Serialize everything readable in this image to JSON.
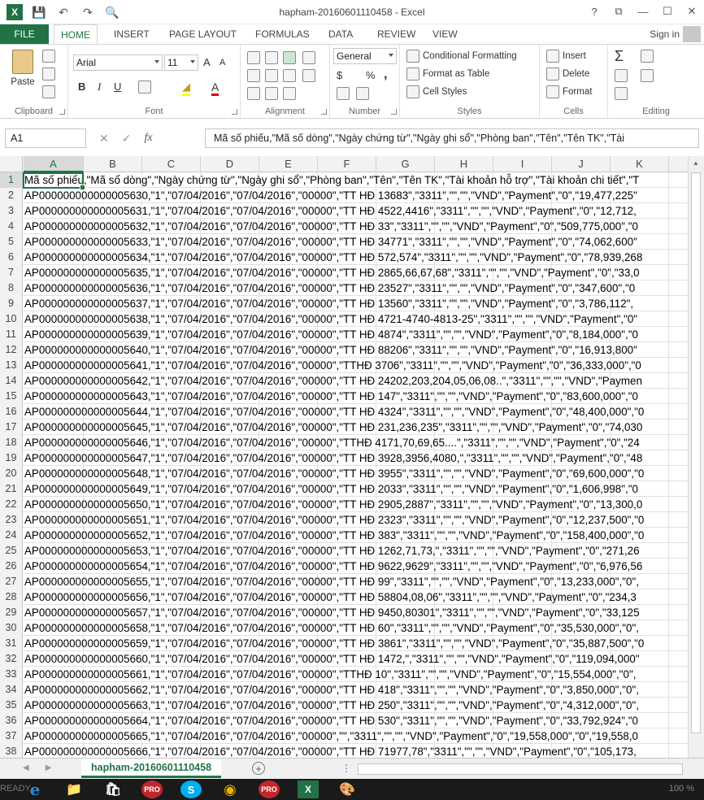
{
  "window": {
    "title": "hapham-20160601110458 - Excel",
    "help": "?",
    "ribbon_display": "⧉",
    "minimize": "—",
    "maximize": "☐",
    "close": "✕"
  },
  "qat": {
    "app_logo": "X",
    "save": "💾",
    "undo": "↶",
    "redo": "↷",
    "preview": "🔍"
  },
  "tabs": {
    "file": "FILE",
    "items": [
      "HOME",
      "INSERT",
      "PAGE LAYOUT",
      "FORMULAS",
      "DATA",
      "REVIEW",
      "VIEW"
    ],
    "signin": "Sign in"
  },
  "ribbon": {
    "clipboard": {
      "label": "Clipboard",
      "paste": "Paste"
    },
    "font": {
      "label": "Font",
      "name": "Arial",
      "size": "11",
      "grow": "A",
      "shrink": "A",
      "bold": "B",
      "italic": "I",
      "underline": "U",
      "fill": "◢",
      "color": "A"
    },
    "alignment": {
      "label": "Alignment"
    },
    "number": {
      "label": "Number",
      "format": "General",
      "currency": "$",
      "percent": "%",
      "comma": ","
    },
    "styles": {
      "label": "Styles",
      "conditional": "Conditional Formatting",
      "table": "Format as Table",
      "cell_styles": "Cell Styles"
    },
    "cells": {
      "label": "Cells",
      "insert": "Insert",
      "delete": "Delete",
      "format": "Format"
    },
    "editing": {
      "label": "Editing",
      "sum": "Σ"
    }
  },
  "formula_bar": {
    "name_box": "A1",
    "cancel": "✕",
    "enter": "✓",
    "fx": "fx",
    "content": "Mã số phiếu,\"Mã số dòng\",\"Ngày chứng từ\",\"Ngày ghi sổ\",\"Phòng ban\",\"Tên\",\"Tên TK\",\"Tài"
  },
  "columns": [
    "A",
    "B",
    "C",
    "D",
    "E",
    "F",
    "G",
    "H",
    "I",
    "J",
    "K"
  ],
  "rows": [
    {
      "n": "1",
      "text": "Mã số phiếu,\"Mã số dòng\",\"Ngày chứng từ\",\"Ngày ghi sổ\",\"Phòng ban\",\"Tên\",\"Tên TK\",\"Tài khoản hỗ trợ\",\"Tài khoản chi tiết\",\"T"
    },
    {
      "n": "2",
      "text": "AP000000000000005630,\"1\",\"07/04/2016\",\"07/04/2016\",\"00000\",\"TT HĐ 13683\",\"3311\",\"\",\"\",\"VND\",\"Payment\",\"0\",\"19,477,225\""
    },
    {
      "n": "3",
      "text": "AP000000000000005631,\"1\",\"07/04/2016\",\"07/04/2016\",\"00000\",\"TT HĐ 4522,4416\",\"3311\",\"\",\"\",\"VND\",\"Payment\",\"0\",\"12,712,"
    },
    {
      "n": "4",
      "text": "AP000000000000005632,\"1\",\"07/04/2016\",\"07/04/2016\",\"00000\",\"TT HĐ 33\",\"3311\",\"\",\"\",\"VND\",\"Payment\",\"0\",\"509,775,000\",\"0"
    },
    {
      "n": "5",
      "text": "AP000000000000005633,\"1\",\"07/04/2016\",\"07/04/2016\",\"00000\",\"TT HĐ 34771\",\"3311\",\"\",\"\",\"VND\",\"Payment\",\"0\",\"74,062,600\""
    },
    {
      "n": "6",
      "text": "AP000000000000005634,\"1\",\"07/04/2016\",\"07/04/2016\",\"00000\",\"TT HĐ 572,574\",\"3311\",\"\",\"\",\"VND\",\"Payment\",\"0\",\"78,939,268"
    },
    {
      "n": "7",
      "text": "AP000000000000005635,\"1\",\"07/04/2016\",\"07/04/2016\",\"00000\",\"TT HĐ 2865,66,67,68\",\"3311\",\"\",\"\",\"VND\",\"Payment\",\"0\",\"33,0"
    },
    {
      "n": "8",
      "text": "AP000000000000005636,\"1\",\"07/04/2016\",\"07/04/2016\",\"00000\",\"TT HĐ 23527\",\"3311\",\"\",\"\",\"VND\",\"Payment\",\"0\",\"347,600\",\"0"
    },
    {
      "n": "9",
      "text": "AP000000000000005637,\"1\",\"07/04/2016\",\"07/04/2016\",\"00000\",\"TT HĐ 13560\",\"3311\",\"\",\"\",\"VND\",\"Payment\",\"0\",\"3,786,112\","
    },
    {
      "n": "10",
      "text": "AP000000000000005638,\"1\",\"07/04/2016\",\"07/04/2016\",\"00000\",\"TT HĐ 4721-4740-4813-25\",\"3311\",\"\",\"\",\"VND\",\"Payment\",\"0\""
    },
    {
      "n": "11",
      "text": "AP000000000000005639,\"1\",\"07/04/2016\",\"07/04/2016\",\"00000\",\"TT HĐ 4874\",\"3311\",\"\",\"\",\"VND\",\"Payment\",\"0\",\"8,184,000\",\"0"
    },
    {
      "n": "12",
      "text": "AP000000000000005640,\"1\",\"07/04/2016\",\"07/04/2016\",\"00000\",\"TT HĐ 88206\",\"3311\",\"\",\"\",\"VND\",\"Payment\",\"0\",\"16,913,800\""
    },
    {
      "n": "13",
      "text": "AP000000000000005641,\"1\",\"07/04/2016\",\"07/04/2016\",\"00000\",\"TTHĐ 3706\",\"3311\",\"\",\"\",\"VND\",\"Payment\",\"0\",\"36,333,000\",\"0"
    },
    {
      "n": "14",
      "text": "AP000000000000005642,\"1\",\"07/04/2016\",\"07/04/2016\",\"00000\",\"TT HĐ 24202,203,204,05,06,08..\",\"3311\",\"\",\"\",\"VND\",\"Paymen"
    },
    {
      "n": "15",
      "text": "AP000000000000005643,\"1\",\"07/04/2016\",\"07/04/2016\",\"00000\",\"TT HĐ 147\",\"3311\",\"\",\"\",\"VND\",\"Payment\",\"0\",\"83,600,000\",\"0"
    },
    {
      "n": "16",
      "text": "AP000000000000005644,\"1\",\"07/04/2016\",\"07/04/2016\",\"00000\",\"TT HĐ 4324\",\"3311\",\"\",\"\",\"VND\",\"Payment\",\"0\",\"48,400,000\",\"0"
    },
    {
      "n": "17",
      "text": "AP000000000000005645,\"1\",\"07/04/2016\",\"07/04/2016\",\"00000\",\"TT HĐ 231,236,235\",\"3311\",\"\",\"\",\"VND\",\"Payment\",\"0\",\"74,030"
    },
    {
      "n": "18",
      "text": "AP000000000000005646,\"1\",\"07/04/2016\",\"07/04/2016\",\"00000\",\"TTHĐ 4171,70,69,65....\",\"3311\",\"\",\"\",\"VND\",\"Payment\",\"0\",\"24"
    },
    {
      "n": "19",
      "text": "AP000000000000005647,\"1\",\"07/04/2016\",\"07/04/2016\",\"00000\",\"TT HĐ 3928,3956,4080,\",\"3311\",\"\",\"\",\"VND\",\"Payment\",\"0\",\"48"
    },
    {
      "n": "20",
      "text": "AP000000000000005648,\"1\",\"07/04/2016\",\"07/04/2016\",\"00000\",\"TT HĐ 3955\",\"3311\",\"\",\"\",\"VND\",\"Payment\",\"0\",\"69,600,000\",\"0"
    },
    {
      "n": "21",
      "text": "AP000000000000005649,\"1\",\"07/04/2016\",\"07/04/2016\",\"00000\",\"TT HĐ 2033\",\"3311\",\"\",\"\",\"VND\",\"Payment\",\"0\",\"1,606,998\",\"0"
    },
    {
      "n": "22",
      "text": "AP000000000000005650,\"1\",\"07/04/2016\",\"07/04/2016\",\"00000\",\"TT HĐ 2905,2887\",\"3311\",\"\",\"\",\"VND\",\"Payment\",\"0\",\"13,300,0"
    },
    {
      "n": "23",
      "text": "AP000000000000005651,\"1\",\"07/04/2016\",\"07/04/2016\",\"00000\",\"TT HĐ 2323\",\"3311\",\"\",\"\",\"VND\",\"Payment\",\"0\",\"12,237,500\",\"0"
    },
    {
      "n": "24",
      "text": "AP000000000000005652,\"1\",\"07/04/2016\",\"07/04/2016\",\"00000\",\"TT HĐ 383\",\"3311\",\"\",\"\",\"VND\",\"Payment\",\"0\",\"158,400,000\",\"0"
    },
    {
      "n": "25",
      "text": "AP000000000000005653,\"1\",\"07/04/2016\",\"07/04/2016\",\"00000\",\"TT HĐ 1262,71,73,\",\"3311\",\"\",\"\",\"VND\",\"Payment\",\"0\",\"271,26"
    },
    {
      "n": "26",
      "text": "AP000000000000005654,\"1\",\"07/04/2016\",\"07/04/2016\",\"00000\",\"TT HĐ 9622,9629\",\"3311\",\"\",\"\",\"VND\",\"Payment\",\"0\",\"6,976,56"
    },
    {
      "n": "27",
      "text": "AP000000000000005655,\"1\",\"07/04/2016\",\"07/04/2016\",\"00000\",\"TT HĐ 99\",\"3311\",\"\",\"\",\"VND\",\"Payment\",\"0\",\"13,233,000\",\"0\","
    },
    {
      "n": "28",
      "text": "AP000000000000005656,\"1\",\"07/04/2016\",\"07/04/2016\",\"00000\",\"TT HĐ 58804,08,06\",\"3311\",\"\",\"\",\"VND\",\"Payment\",\"0\",\"234,3"
    },
    {
      "n": "29",
      "text": "AP000000000000005657,\"1\",\"07/04/2016\",\"07/04/2016\",\"00000\",\"TT HĐ 9450,80301\",\"3311\",\"\",\"\",\"VND\",\"Payment\",\"0\",\"33,125"
    },
    {
      "n": "30",
      "text": "AP000000000000005658,\"1\",\"07/04/2016\",\"07/04/2016\",\"00000\",\"TT HĐ 60\",\"3311\",\"\",\"\",\"VND\",\"Payment\",\"0\",\"35,530,000\",\"0\","
    },
    {
      "n": "31",
      "text": "AP000000000000005659,\"1\",\"07/04/2016\",\"07/04/2016\",\"00000\",\"TT HĐ 3861\",\"3311\",\"\",\"\",\"VND\",\"Payment\",\"0\",\"35,887,500\",\"0"
    },
    {
      "n": "32",
      "text": "AP000000000000005660,\"1\",\"07/04/2016\",\"07/04/2016\",\"00000\",\"TT HĐ 1472,\",\"3311\",\"\",\"\",\"VND\",\"Payment\",\"0\",\"119,094,000\""
    },
    {
      "n": "33",
      "text": "AP000000000000005661,\"1\",\"07/04/2016\",\"07/04/2016\",\"00000\",\"TTHĐ 10\",\"3311\",\"\",\"\",\"VND\",\"Payment\",\"0\",\"15,554,000\",\"0\","
    },
    {
      "n": "34",
      "text": "AP000000000000005662,\"1\",\"07/04/2016\",\"07/04/2016\",\"00000\",\"TT HĐ 418\",\"3311\",\"\",\"\",\"VND\",\"Payment\",\"0\",\"3,850,000\",\"0\","
    },
    {
      "n": "35",
      "text": "AP000000000000005663,\"1\",\"07/04/2016\",\"07/04/2016\",\"00000\",\"TT HĐ 250\",\"3311\",\"\",\"\",\"VND\",\"Payment\",\"0\",\"4,312,000\",\"0\","
    },
    {
      "n": "36",
      "text": "AP000000000000005664,\"1\",\"07/04/2016\",\"07/04/2016\",\"00000\",\"TT HĐ 530\",\"3311\",\"\",\"\",\"VND\",\"Payment\",\"0\",\"33,792,924\",\"0"
    },
    {
      "n": "37",
      "text": "AP000000000000005665,\"1\",\"07/04/2016\",\"07/04/2016\",\"00000\",\"\",\"3311\",\"\",\"\",\"VND\",\"Payment\",\"0\",\"19,558,000\",\"0\",\"19,558,0"
    },
    {
      "n": "38",
      "text": "AP000000000000005666,\"1\",\"07/04/2016\",\"07/04/2016\",\"00000\",\"TT HĐ 71977,78\",\"3311\",\"\",\"\",\"VND\",\"Payment\",\"0\",\"105,173,"
    }
  ],
  "sheet": {
    "tab_name": "hapham-20160601110458",
    "add": "+",
    "more": "⋮"
  },
  "status": {
    "ready": "READY",
    "zoom": "100 %"
  },
  "taskbar": {
    "apps": [
      "e",
      "📁",
      "🛍",
      "PRO",
      "S",
      "◉",
      "PRO",
      "X",
      "🎨"
    ]
  },
  "colors": {
    "accent": "#217346"
  }
}
